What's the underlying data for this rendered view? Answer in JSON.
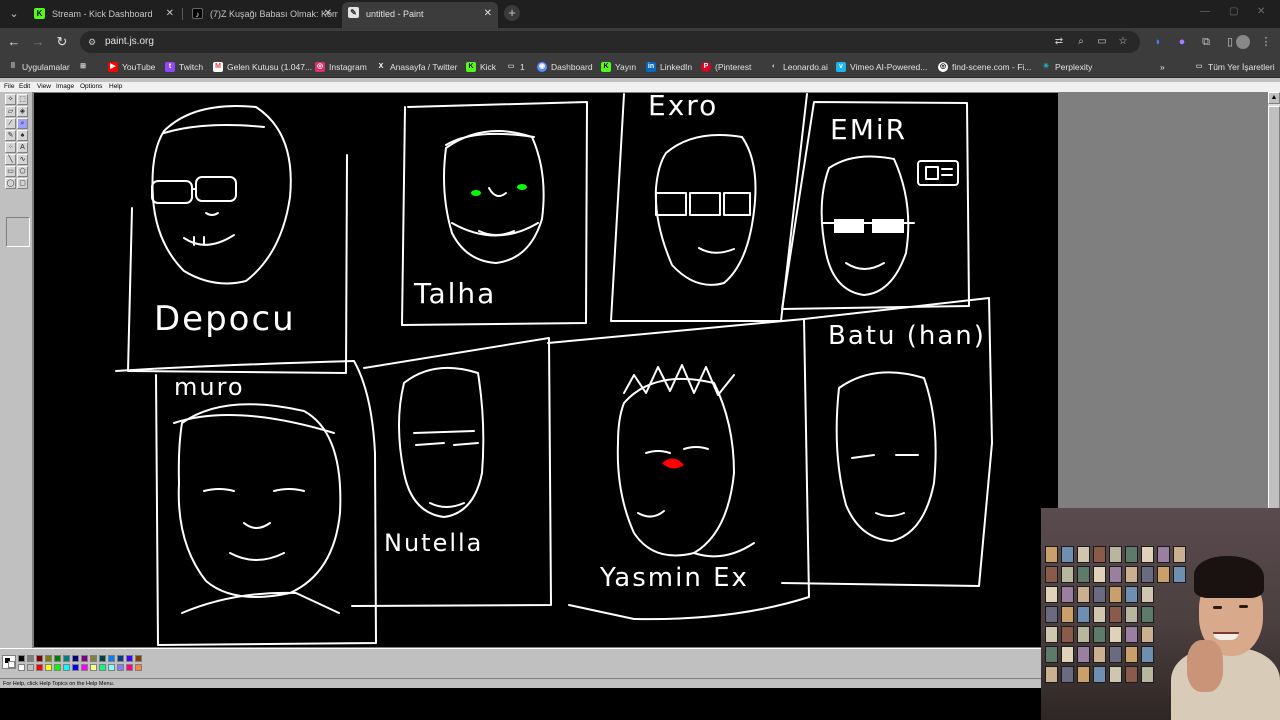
{
  "browser": {
    "tabs": [
      {
        "title": "Stream - Kick Dashboard",
        "icon": "kick-icon",
        "active": false
      },
      {
        "title": "(7)Z Kuşağı Babası Olmak: Kom",
        "icon": "tiktok-icon",
        "active": false
      },
      {
        "title": "untitled - Paint",
        "icon": "paint-icon",
        "active": true
      }
    ],
    "url": "paint.js.org",
    "bookmarks": [
      {
        "label": "Uygulamalar",
        "icon": "apps-icon",
        "color": "#e3e3e3"
      },
      {
        "label": "YouTube",
        "icon": "youtube-icon",
        "color": "#ff0000"
      },
      {
        "label": "Twitch",
        "icon": "twitch-icon",
        "color": "#9146ff"
      },
      {
        "label": "Gelen Kutusu (1.047...",
        "icon": "gmail-icon",
        "color": "#ea4335"
      },
      {
        "label": "Instagram",
        "icon": "instagram-icon",
        "color": "#e1306c"
      },
      {
        "label": "Anasayfa / Twitter",
        "icon": "x-icon",
        "color": "#ffffff"
      },
      {
        "label": "Kick",
        "icon": "kick-icon",
        "color": "#53fc18"
      },
      {
        "label": "1",
        "icon": "folder-icon",
        "color": "#c7c7c7"
      },
      {
        "label": "Dashboard",
        "icon": "dashboard-icon",
        "color": "#5e8bff"
      },
      {
        "label": "Yayın",
        "icon": "kick-icon",
        "color": "#53fc18"
      },
      {
        "label": "LinkedIn",
        "icon": "linkedin-icon",
        "color": "#0a66c2"
      },
      {
        "label": "(Pinterest",
        "icon": "pinterest-icon",
        "color": "#e60023"
      },
      {
        "label": "Leonardo.ai",
        "icon": "leonardo-icon",
        "color": "#c7c7c7"
      },
      {
        "label": "Vimeo AI-Powered...",
        "icon": "vimeo-icon",
        "color": "#1ab7ea"
      },
      {
        "label": "find-scene.com - Fi...",
        "icon": "find-scene-icon",
        "color": "#ffffff"
      },
      {
        "label": "Perplexity",
        "icon": "perplexity-icon",
        "color": "#20b8cd"
      }
    ],
    "all_bookmarks": "Tüm Yer İşaretleri"
  },
  "paint": {
    "menu": [
      "File",
      "Edit",
      "View",
      "Image",
      "Options",
      "Help"
    ],
    "status": "For Help, click Help Topics on the Help Menu.",
    "palette": [
      "#000000",
      "#808080",
      "#800000",
      "#808000",
      "#008000",
      "#008080",
      "#000080",
      "#800080",
      "#808040",
      "#004040",
      "#0080ff",
      "#004080",
      "#4000ff",
      "#804000",
      "#ffffff",
      "#c0c0c0",
      "#ff0000",
      "#ffff00",
      "#00ff00",
      "#00ffff",
      "#0000ff",
      "#ff00ff",
      "#ffff80",
      "#00ff80",
      "#80ffff",
      "#8080ff",
      "#ff0080",
      "#ff8040"
    ],
    "drawing_labels": {
      "depocu": "Depocu",
      "talha": "Talha",
      "exro": "Exro",
      "emir": "EMiR",
      "batu": "Batu (han)",
      "muro": "muro",
      "nutella": "Nutella",
      "yasmin": "Yasmin Ex"
    }
  }
}
